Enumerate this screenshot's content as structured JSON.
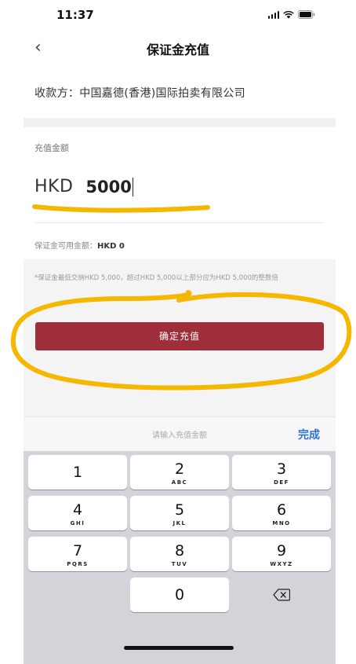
{
  "status": {
    "time": "11:37",
    "signal_icon": "signal-icon",
    "wifi_icon": "wifi-icon",
    "battery_icon": "battery-icon"
  },
  "nav": {
    "back_icon": "chevron-left-icon",
    "back_glyph": "‹",
    "title": "保证金充值"
  },
  "payee": {
    "label": "收款方：",
    "name": "中国嘉德(香港)国际拍卖有限公司"
  },
  "amount": {
    "label": "充值金额",
    "currency": "HKD",
    "value": "5000"
  },
  "available": {
    "label": "保证金可用金额：",
    "value": "HKD 0"
  },
  "notice": "*保证金最低交纳HKD 5,000，超过HKD 5,000以上部分应为HKD 5,000的整数倍",
  "confirm_button": "确定充值",
  "keyboard": {
    "placeholder": "请输入充值金额",
    "done": "完成",
    "keys": [
      {
        "digit": "1",
        "letters": ""
      },
      {
        "digit": "2",
        "letters": "ABC"
      },
      {
        "digit": "3",
        "letters": "DEF"
      },
      {
        "digit": "4",
        "letters": "GHI"
      },
      {
        "digit": "5",
        "letters": "JKL"
      },
      {
        "digit": "6",
        "letters": "MNO"
      },
      {
        "digit": "7",
        "letters": "PQRS"
      },
      {
        "digit": "8",
        "letters": "TUV"
      },
      {
        "digit": "9",
        "letters": "WXYZ"
      },
      {
        "digit": "0",
        "letters": ""
      }
    ],
    "backspace_icon": "backspace-icon"
  },
  "colors": {
    "primary_button": "#9e2f3a",
    "done_link": "#2f6fdc",
    "annotation_marker": "#f5b700"
  }
}
